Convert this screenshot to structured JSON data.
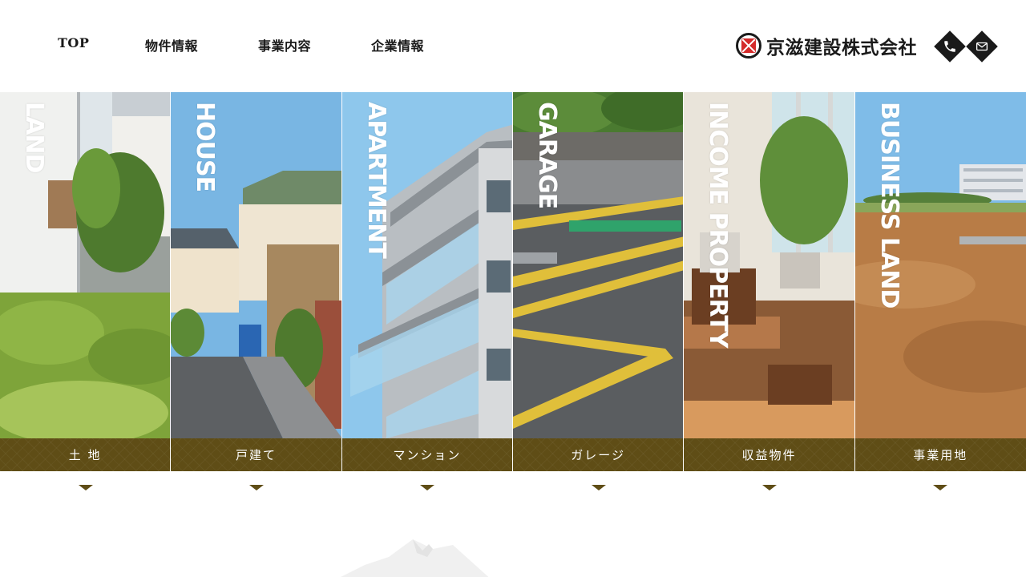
{
  "nav": {
    "items": [
      "TOP",
      "物件情報",
      "事業内容",
      "企業情報"
    ]
  },
  "brand": {
    "name": "京滋建設株式会社"
  },
  "contact": {
    "phone_icon": "phone-icon",
    "mail_icon": "mail-icon"
  },
  "categories": [
    {
      "en": "LAND",
      "label": "土 地"
    },
    {
      "en": "HOUSE",
      "label": "戸建て"
    },
    {
      "en": "APARTMENT",
      "label": "マンション"
    },
    {
      "en": "GARAGE",
      "label": "ガレージ"
    },
    {
      "en": "INCOME PROPERTY",
      "label": "収益物件"
    },
    {
      "en": "BUSINESS LAND",
      "label": "事業用地"
    }
  ],
  "colors": {
    "label_bg": "#5f4d16",
    "brand_red": "#d42a2a",
    "text": "#1a1a1a"
  }
}
